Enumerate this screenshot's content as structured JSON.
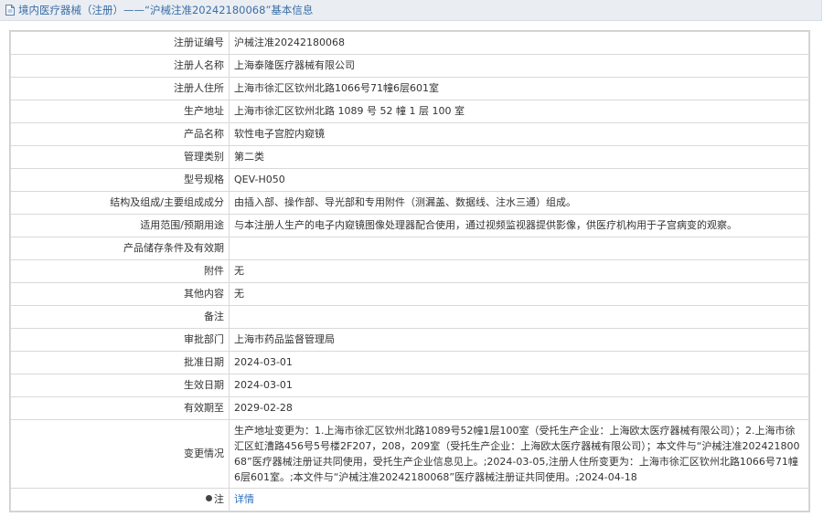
{
  "header": {
    "title": "境内医疗器械（注册）——“沪械注准20242180068”基本信息"
  },
  "rows": [
    {
      "label": "注册证编号",
      "value": "沪械注准20242180068"
    },
    {
      "label": "注册人名称",
      "value": "上海泰隆医疗器械有限公司"
    },
    {
      "label": "注册人住所",
      "value": "上海市徐汇区钦州北路1066号71幢6层601室"
    },
    {
      "label": "生产地址",
      "value": "上海市徐汇区钦州北路 1089 号 52 幢 1 层 100 室"
    },
    {
      "label": "产品名称",
      "value": "软性电子宫腔内窥镜"
    },
    {
      "label": "管理类别",
      "value": "第二类"
    },
    {
      "label": "型号规格",
      "value": "QEV-H050"
    },
    {
      "label": "结构及组成/主要组成成分",
      "value": "由插入部、操作部、导光部和专用附件（测漏盖、数据线、注水三通）组成。"
    },
    {
      "label": "适用范围/预期用途",
      "value": "与本注册人生产的电子内窥镜图像处理器配合使用，通过视频监视器提供影像，供医疗机构用于子宫病变的观察。"
    },
    {
      "label": "产品储存条件及有效期",
      "value": ""
    },
    {
      "label": "附件",
      "value": "无"
    },
    {
      "label": "其他内容",
      "value": "无"
    },
    {
      "label": "备注",
      "value": ""
    },
    {
      "label": "审批部门",
      "value": "上海市药品监督管理局"
    },
    {
      "label": "批准日期",
      "value": "2024-03-01"
    },
    {
      "label": "生效日期",
      "value": "2024-03-01"
    },
    {
      "label": "有效期至",
      "value": "2029-02-28"
    }
  ],
  "change": {
    "label": "变更情况",
    "value": "生产地址变更为：1.上海市徐汇区钦州北路1089号52幢1层100室（受托生产企业：上海欧太医疗器械有限公司）；2.上海市徐汇区虹漕路456号5号楼2F207，208，209室（受托生产企业：上海欧太医疗器械有限公司）；本文件与“沪械注准20242180068”医疗器械注册证共同使用，受托生产企业信息见上。;2024-03-05,注册人住所变更为：上海市徐汇区钦州北路1066号71幢6层601室。;本文件与“沪械注准20242180068”医疗器械注册证共同使用。;2024-04-18"
  },
  "note": {
    "label": "注",
    "link": "详情"
  },
  "colors": {
    "title_bg": "#eaeef3",
    "title_text": "#3a6ea5",
    "link": "#2a6ebb",
    "border": "#d9d9d9"
  },
  "icons": {
    "title": "document-icon",
    "note": "pin-icon"
  }
}
